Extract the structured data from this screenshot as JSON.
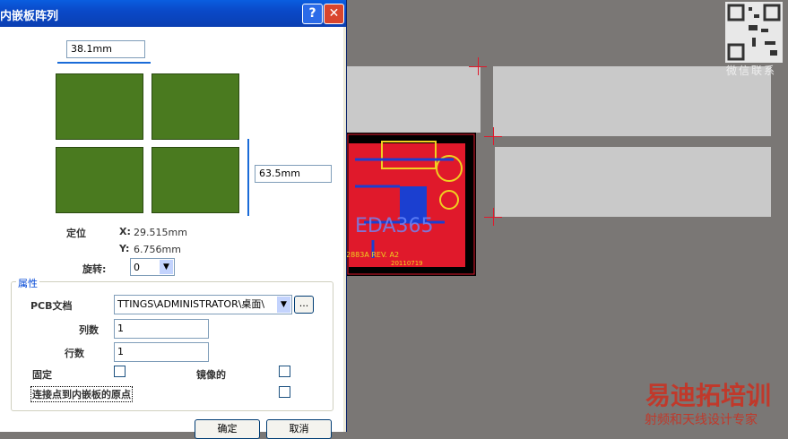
{
  "dialog": {
    "title": "内嵌板阵列",
    "help_label": "?",
    "close_label": "✕",
    "width_measure": "38.1mm",
    "height_measure": "63.5mm",
    "position": {
      "label": "定位",
      "x_label": "X:",
      "x_value": "29.515mm",
      "y_label": "Y:",
      "y_value": "6.756mm"
    },
    "rotation": {
      "label": "旋转:",
      "value": "0"
    },
    "properties": {
      "group_label": "属性",
      "pcb_doc_label": "PCB文档",
      "pcb_doc_value": "TTINGS\\ADMINISTRATOR\\桌面\\",
      "browse_label": "...",
      "columns_label": "列数",
      "columns_value": "1",
      "rows_label": "行数",
      "rows_value": "1",
      "fixed_label": "固定",
      "mirror_label": "镜像的",
      "connect_origin_label": "连接点到内嵌板的原点"
    },
    "ok_label": "确定",
    "cancel_label": "取消"
  },
  "canvas": {
    "pcb_text_main": "EDA365",
    "pcb_text_rev": "2883A  REV. A2",
    "pcb_text_date": "20110719"
  },
  "watermark": {
    "qr_caption": "微信联系",
    "brand": "易迪拓培训",
    "tagline": "射频和天线设计专家"
  },
  "colors": {
    "title_bar": "#0a49c8",
    "pcb_red": "#e0192b",
    "board_green": "#4a7a1f",
    "brand_red": "#c0392b"
  }
}
